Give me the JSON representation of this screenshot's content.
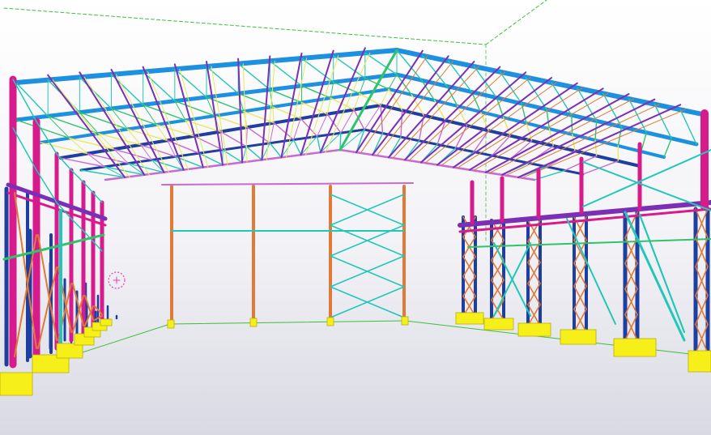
{
  "viewport": {
    "background_top": "#ffffff",
    "background_bottom": "#d9d9e3"
  },
  "model": {
    "palette": {
      "rafter": "#1e90e0",
      "column_magenta": "#d81b8c",
      "column_blue": "#1f3fa0",
      "column_orange": "#e07a36",
      "bracing_teal": "#22c7b8",
      "bracing_green": "#2ec46a",
      "purlin_purple": "#7a2fb5",
      "purlin_violet": "#c86ad0",
      "truss_yellow": "#e8e85a",
      "footing_yellow": "#f7ef1a",
      "work_plane_green": "#3cbf3c",
      "crosshair_magenta": "#e040c0"
    },
    "elements": [
      "rafter",
      "column",
      "truss",
      "purlin",
      "bracing",
      "footing",
      "work-plane",
      "crosshair"
    ]
  }
}
